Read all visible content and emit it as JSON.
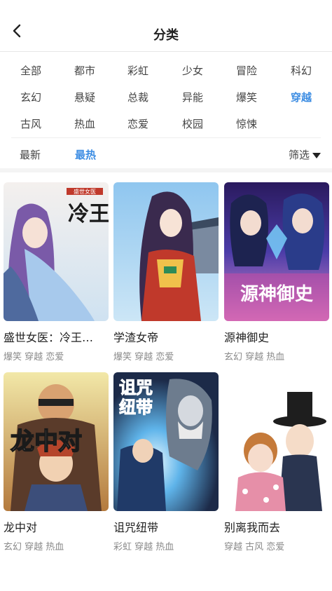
{
  "header": {
    "title": "分类",
    "back_icon": "chevron-left-icon"
  },
  "genres": [
    {
      "label": "全部",
      "active": false
    },
    {
      "label": "都市",
      "active": false
    },
    {
      "label": "彩虹",
      "active": false
    },
    {
      "label": "少女",
      "active": false
    },
    {
      "label": "冒险",
      "active": false
    },
    {
      "label": "科幻",
      "active": false
    },
    {
      "label": "玄幻",
      "active": false
    },
    {
      "label": "悬疑",
      "active": false
    },
    {
      "label": "总裁",
      "active": false
    },
    {
      "label": "异能",
      "active": false
    },
    {
      "label": "爆笑",
      "active": false
    },
    {
      "label": "穿越",
      "active": true
    },
    {
      "label": "古风",
      "active": false
    },
    {
      "label": "热血",
      "active": false
    },
    {
      "label": "恋爱",
      "active": false
    },
    {
      "label": "校园",
      "active": false
    },
    {
      "label": "惊悚",
      "active": false
    }
  ],
  "sort": {
    "newest": "最新",
    "hottest": "最热",
    "active": "hottest",
    "filter": "筛选"
  },
  "accent_color": "#3e8ee3",
  "comics": [
    {
      "title": "盛世女医：冷王…",
      "tags": "爆笑 穿越 恋爱",
      "cover_text": "盛世女医 冷王的"
    },
    {
      "title": "学渣女帝",
      "tags": "爆笑 穿越 恋爱"
    },
    {
      "title": "源神御史",
      "tags": "玄幻 穿越 热血",
      "cover_text": "源神御史"
    },
    {
      "title": "龙中对",
      "tags": "玄幻 穿越 热血",
      "cover_text": "龙中对"
    },
    {
      "title": "诅咒纽带",
      "tags": "彩虹 穿越 热血",
      "cover_text": "诅咒 纽带"
    },
    {
      "title": "别离我而去",
      "tags": "穿越 古风 恋爱"
    }
  ]
}
